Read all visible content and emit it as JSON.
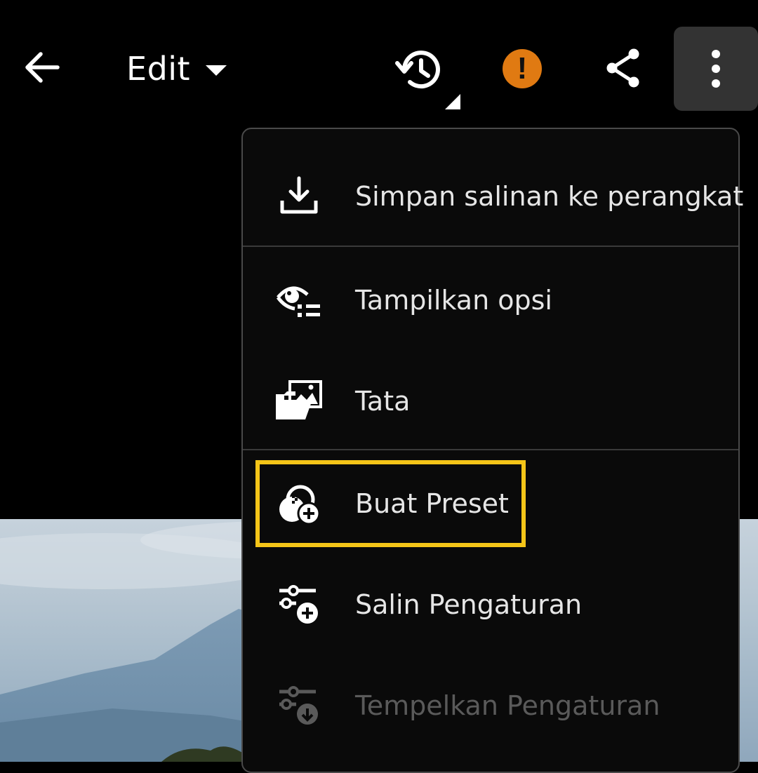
{
  "header": {
    "edit_label": "Edit"
  },
  "icons": {
    "back": "back-arrow-icon",
    "history": "history-icon",
    "alert": "alert-icon",
    "share": "share-icon",
    "more": "more-vertical-icon"
  },
  "alert": {
    "symbol": "!"
  },
  "colors": {
    "background": "#000000",
    "menu_bg": "#0a0a0a",
    "alert": "#e07a12",
    "highlight": "#f5c518",
    "disabled_text": "#5a5a5a"
  },
  "menu": {
    "items": [
      {
        "label": "Simpan salinan ke perangkat",
        "icon": "download-icon",
        "enabled": true
      },
      {
        "label": "Tampilkan opsi",
        "icon": "view-options-icon",
        "enabled": true
      },
      {
        "label": "Tata",
        "icon": "organize-folder-icon",
        "enabled": true
      },
      {
        "label": "Buat Preset",
        "icon": "create-preset-icon",
        "enabled": true,
        "highlighted": true
      },
      {
        "label": "Salin Pengaturan",
        "icon": "copy-settings-icon",
        "enabled": true
      },
      {
        "label": "Tempelkan Pengaturan",
        "icon": "paste-settings-icon",
        "enabled": false
      }
    ]
  }
}
